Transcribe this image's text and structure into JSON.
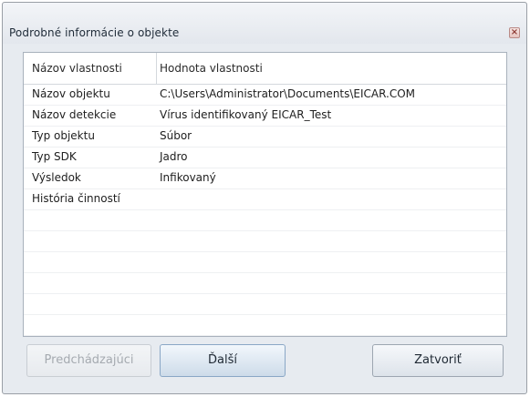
{
  "window": {
    "title": "Podrobné informácie o objekte",
    "close_icon_glyph": "×"
  },
  "table": {
    "headers": [
      "Názov vlastnosti",
      "Hodnota vlastnosti"
    ],
    "rows": [
      [
        "Názov objektu",
        "C:\\Users\\Administrator\\Documents\\EICAR.COM"
      ],
      [
        "Názov detekcie",
        "Vírus identifikovaný EICAR_Test"
      ],
      [
        "Typ objektu",
        "Súbor"
      ],
      [
        "Typ SDK",
        "Jadro"
      ],
      [
        "Výsledok",
        "Infikovaný"
      ],
      [
        "História činností",
        ""
      ],
      [
        "",
        ""
      ],
      [
        "",
        ""
      ],
      [
        "",
        ""
      ],
      [
        "",
        ""
      ],
      [
        "",
        ""
      ],
      [
        "",
        ""
      ]
    ]
  },
  "buttons": {
    "prev_label": "Predchádzajúci",
    "next_label": "Ďalší",
    "close_label": "Zatvoriť"
  }
}
